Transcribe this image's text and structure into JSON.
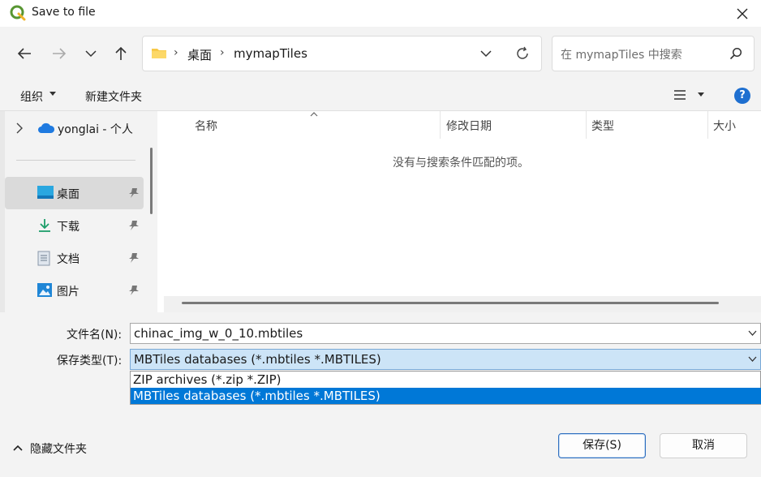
{
  "window": {
    "title": "Save to file",
    "close_glyph": "✕"
  },
  "nav": {
    "breadcrumb": [
      "桌面",
      "mymapTiles"
    ],
    "breadcrumb_sep": "›",
    "search_placeholder": "在 mymapTiles 中搜索"
  },
  "toolbar": {
    "organize": "组织",
    "new_folder": "新建文件夹",
    "help": "?"
  },
  "sidebar": {
    "onedrive": "yonglai - 个人",
    "items": [
      {
        "label": "桌面",
        "icon": "desktop-icon",
        "active": true
      },
      {
        "label": "下载",
        "icon": "download-icon",
        "active": false
      },
      {
        "label": "文档",
        "icon": "document-icon",
        "active": false
      },
      {
        "label": "图片",
        "icon": "picture-icon",
        "active": false
      }
    ]
  },
  "columns": [
    "名称",
    "修改日期",
    "类型",
    "大小"
  ],
  "empty_message": "没有与搜索条件匹配的项。",
  "form": {
    "filename_label": "文件名(N):",
    "filename_value": "chinac_img_w_0_10.mbtiles",
    "filetype_label": "保存类型(T):",
    "filetype_value": "MBTiles databases (*.mbtiles *.MBTILES)",
    "filetype_options": [
      {
        "label": "ZIP archives (*.zip *.ZIP)",
        "highlighted": false
      },
      {
        "label": "MBTiles databases (*.mbtiles *.MBTILES)",
        "highlighted": true
      }
    ]
  },
  "footer": {
    "hide_folders": "隐藏文件夹",
    "save": "保存(S)",
    "cancel": "取消"
  },
  "colors": {
    "accent": "#0078d7",
    "selected_field": "#cce4f7",
    "help_bg": "#1e6fd0",
    "qgis_green": "#589632"
  }
}
